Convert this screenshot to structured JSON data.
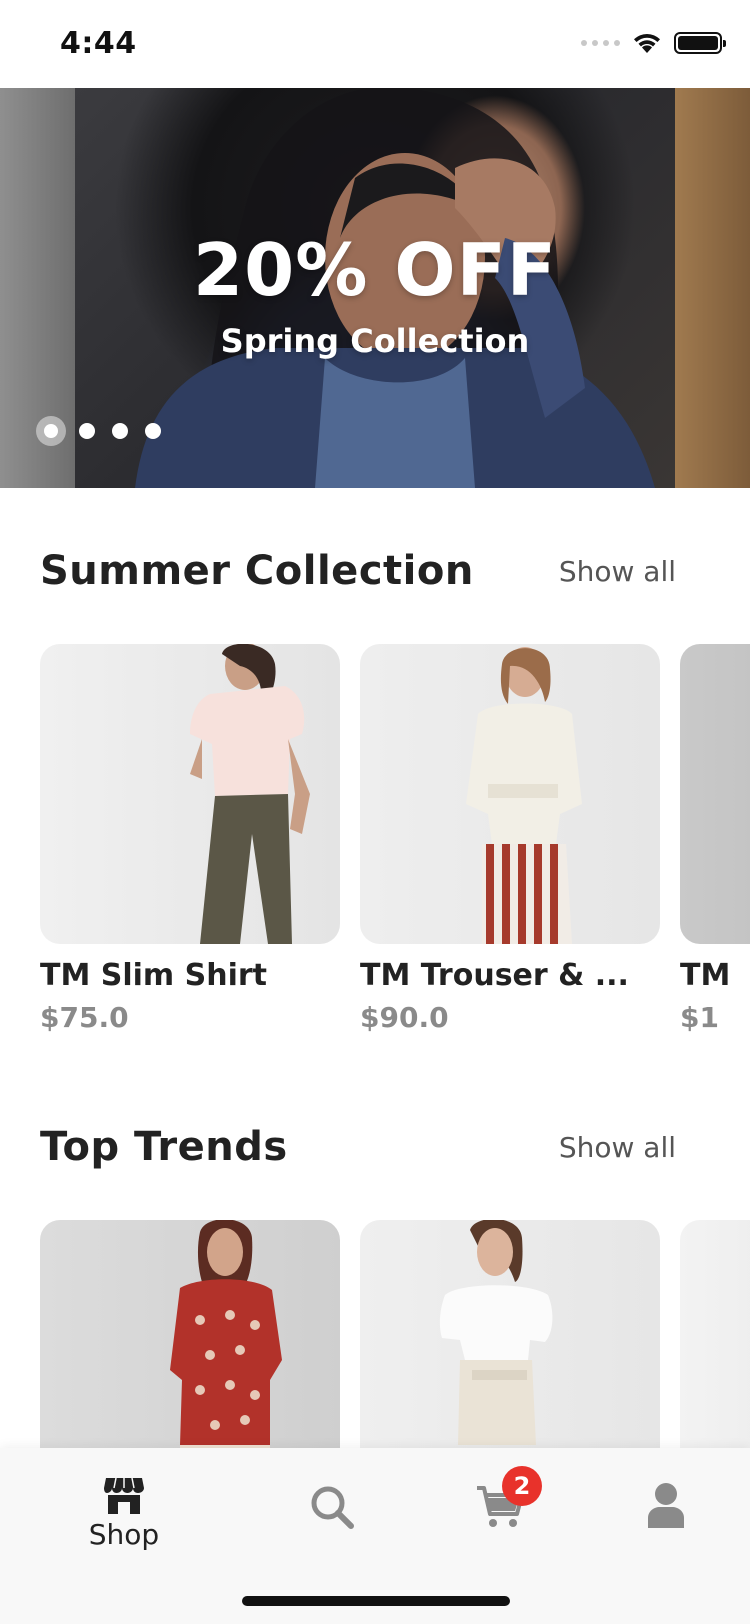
{
  "status_bar": {
    "time": "4:44"
  },
  "banner": {
    "title": "20% OFF",
    "subtitle": "Spring Collection",
    "page_count": 4,
    "active_page": 1
  },
  "sections": [
    {
      "title": "Summer Collection",
      "show_all_label": "Show all",
      "products": [
        {
          "name": "TM Slim Shirt",
          "price": "$75.0"
        },
        {
          "name": "TM Trouser & ...",
          "price": "$90.0"
        },
        {
          "name": "TM",
          "price": "$1"
        }
      ]
    },
    {
      "title": "Top Trends",
      "show_all_label": "Show all",
      "products": [
        {
          "name": "",
          "price": ""
        },
        {
          "name": "",
          "price": ""
        },
        {
          "name": "",
          "price": ""
        }
      ]
    }
  ],
  "bottom_nav": {
    "items": [
      {
        "label": "Shop",
        "icon": "shop-icon",
        "active": true
      },
      {
        "label": "",
        "icon": "search-icon",
        "active": false
      },
      {
        "label": "",
        "icon": "cart-icon",
        "active": false,
        "badge": "2"
      },
      {
        "label": "",
        "icon": "profile-icon",
        "active": false
      }
    ]
  },
  "colors": {
    "accent": "#e8322b",
    "text_primary": "#222222",
    "text_secondary": "#8a8a8a",
    "nav_background": "#f8f8f8"
  }
}
